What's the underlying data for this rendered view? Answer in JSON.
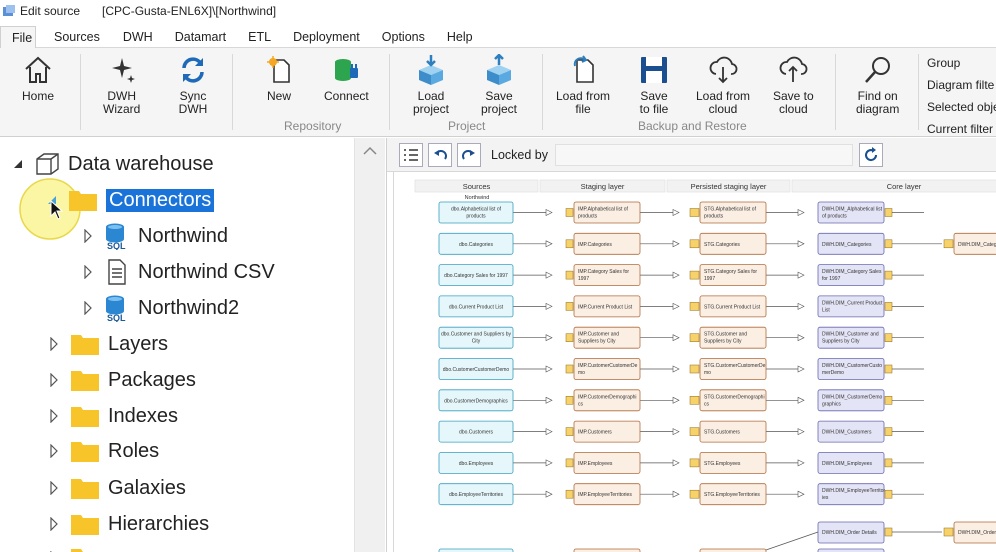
{
  "window": {
    "title": "Edit source",
    "path": "[CPC-Gusta-ENL6X]\\[Northwind]"
  },
  "menu": {
    "tabs": [
      "File",
      "Sources",
      "DWH",
      "Datamart",
      "ETL",
      "Deployment",
      "Options",
      "Help"
    ],
    "active": "File"
  },
  "ribbon": {
    "home": "Home",
    "dwh_wizard": [
      "DWH",
      "Wizard"
    ],
    "sync_dwh": [
      "Sync",
      "DWH"
    ],
    "new": "New",
    "connect": "Connect",
    "repository_label": "Repository",
    "load_project": [
      "Load",
      "project"
    ],
    "save_project": [
      "Save",
      "project"
    ],
    "project_label": "Project",
    "load_from_file": [
      "Load from",
      "file"
    ],
    "save_to_file": [
      "Save",
      "to file"
    ],
    "load_from_cloud": [
      "Load from",
      "cloud"
    ],
    "save_to_cloud": [
      "Save to",
      "cloud"
    ],
    "backup_label": "Backup and Restore",
    "find_on_diagram": [
      "Find on",
      "diagram"
    ],
    "right_list": [
      "Group",
      "Diagram filte",
      "Selected obje",
      "Current filter"
    ]
  },
  "tree": {
    "root": "Data warehouse",
    "connectors": "Connectors",
    "children": [
      "Northwind",
      "Northwind CSV",
      "Northwind2"
    ],
    "folders": [
      "Layers",
      "Packages",
      "Indexes",
      "Roles",
      "Galaxies",
      "Hierarchies"
    ]
  },
  "diagram_toolbar": {
    "locked_by_label": "Locked by",
    "locked_by_value": ""
  },
  "diagram": {
    "columns": [
      "Sources",
      "Staging layer",
      "Persisted staging layer",
      "Core layer"
    ],
    "source_group": "Northwind",
    "rows": [
      {
        "src": [
          "dbo.Alphabetical list of",
          "products"
        ],
        "stg": [
          "IMP.Alphabetical list of",
          "products"
        ],
        "psa": [
          "STG.Alphabetical list of",
          "products"
        ],
        "core": [
          "DWH.DIM_Alphabetical list",
          "of products"
        ]
      },
      {
        "src": [
          "dbo.Categories"
        ],
        "stg": [
          "IMP.Categories"
        ],
        "psa": [
          "STG.Categories"
        ],
        "core": [
          "DWH.DIM_Categories"
        ],
        "extra": "DWH.DIM_Categ"
      },
      {
        "src": [
          "dbo.Category Sales for 1997"
        ],
        "stg": [
          "IMP.Category Sales for",
          "1997"
        ],
        "psa": [
          "STG.Category Sales for",
          "1997"
        ],
        "core": [
          "DWH.DIM_Category Sales",
          "for 1997"
        ]
      },
      {
        "src": [
          "dbo.Current Product List"
        ],
        "stg": [
          "IMP.Current Product List"
        ],
        "psa": [
          "STG.Current Product List"
        ],
        "core": [
          "DWH.DIM_Current Product",
          "List"
        ]
      },
      {
        "src": [
          "dbo.Customer and Suppliers by",
          "City"
        ],
        "stg": [
          "IMP.Customer and",
          "Suppliers by City"
        ],
        "psa": [
          "STG.Customer and",
          "Suppliers by City"
        ],
        "core": [
          "DWH.DIM_Customer and",
          "Suppliers by City"
        ]
      },
      {
        "src": [
          "dbo.CustomerCustomerDemo"
        ],
        "stg": [
          "IMP.CustomerCustomerDe",
          "mo"
        ],
        "psa": [
          "STG.CustomerCustomerDe",
          "mo"
        ],
        "core": [
          "DWH.DIM_CustomerCusto",
          "merDemo"
        ]
      },
      {
        "src": [
          "dbo.CustomerDemographics"
        ],
        "stg": [
          "IMP.CustomerDemographi",
          "cs"
        ],
        "psa": [
          "STG.CustomerDemographi",
          "cs"
        ],
        "core": [
          "DWH.DIM_CustomerDemo",
          "graphics"
        ]
      },
      {
        "src": [
          "dbo.Customers"
        ],
        "stg": [
          "IMP.Customers"
        ],
        "psa": [
          "STG.Customers"
        ],
        "core": [
          "DWH.DIM_Customers"
        ]
      },
      {
        "src": [
          "dbo.Employees"
        ],
        "stg": [
          "IMP.Employees"
        ],
        "psa": [
          "STG.Employees"
        ],
        "core": [
          "DWH.DIM_Employees"
        ]
      },
      {
        "src": [
          "dbo.EmployeeTerritories"
        ],
        "stg": [
          "IMP.EmployeeTerritories"
        ],
        "psa": [
          "STG.EmployeeTerritories"
        ],
        "core": [
          "DWH.DIM_EmployeeTerritor",
          "ies"
        ]
      }
    ],
    "order_details": "DWH.DIM_Order Details",
    "order_details_extra": "DWH.DIM_Order"
  },
  "colors": {
    "src_fill": "#e6f7fb",
    "src_stroke": "#3a9fbf",
    "stg_fill": "#fbeee3",
    "stg_stroke": "#b06b3c",
    "core_fill": "#e4e4f7",
    "core_stroke": "#6868b0",
    "selection": "#1a73d9",
    "folder": "#f7c42a",
    "cursor_highlight": "#f7ee5a"
  }
}
